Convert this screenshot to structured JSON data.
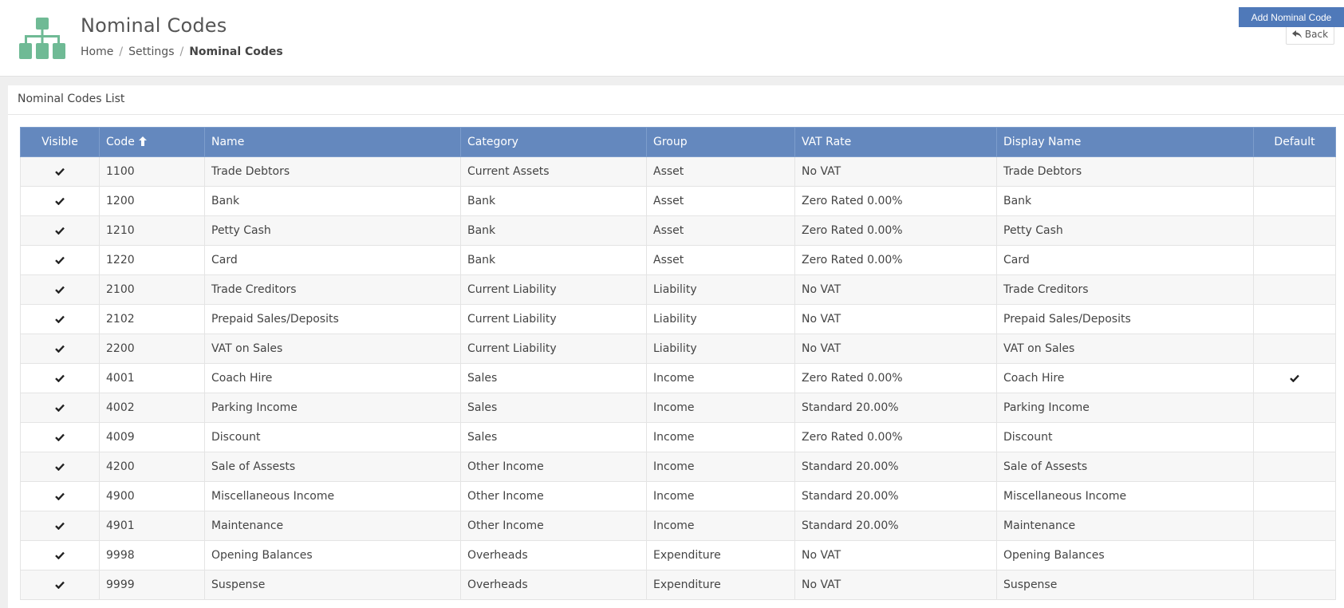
{
  "header": {
    "title": "Nominal Codes",
    "breadcrumb": [
      "Home",
      "Settings",
      "Nominal Codes"
    ],
    "back_label": "Back"
  },
  "colors": {
    "logo": "#6fba95",
    "table_header": "#6488be",
    "primary_button": "#4f79b9"
  },
  "panel": {
    "title": "Nominal Codes List",
    "add_button": "Add Nominal Code"
  },
  "table": {
    "columns": [
      "Visible",
      "Code",
      "Name",
      "Category",
      "Group",
      "VAT Rate",
      "Display Name",
      "Default"
    ],
    "sort": {
      "column": "Code",
      "direction": "ascending"
    },
    "rows": [
      {
        "visible": true,
        "code": "1100",
        "name": "Trade Debtors",
        "category": "Current Assets",
        "group": "Asset",
        "vat": "No VAT",
        "display": "Trade Debtors",
        "default": false
      },
      {
        "visible": true,
        "code": "1200",
        "name": "Bank",
        "category": "Bank",
        "group": "Asset",
        "vat": "Zero Rated 0.00%",
        "display": "Bank",
        "default": false
      },
      {
        "visible": true,
        "code": "1210",
        "name": "Petty Cash",
        "category": "Bank",
        "group": "Asset",
        "vat": "Zero Rated 0.00%",
        "display": "Petty Cash",
        "default": false
      },
      {
        "visible": true,
        "code": "1220",
        "name": "Card",
        "category": "Bank",
        "group": "Asset",
        "vat": "Zero Rated 0.00%",
        "display": "Card",
        "default": false
      },
      {
        "visible": true,
        "code": "2100",
        "name": "Trade Creditors",
        "category": "Current Liability",
        "group": "Liability",
        "vat": "No VAT",
        "display": "Trade Creditors",
        "default": false
      },
      {
        "visible": true,
        "code": "2102",
        "name": "Prepaid Sales/Deposits",
        "category": "Current Liability",
        "group": "Liability",
        "vat": "No VAT",
        "display": "Prepaid Sales/Deposits",
        "default": false
      },
      {
        "visible": true,
        "code": "2200",
        "name": "VAT on Sales",
        "category": "Current Liability",
        "group": "Liability",
        "vat": "No VAT",
        "display": "VAT on Sales",
        "default": false
      },
      {
        "visible": true,
        "code": "4001",
        "name": "Coach Hire",
        "category": "Sales",
        "group": "Income",
        "vat": "Zero Rated 0.00%",
        "display": "Coach Hire",
        "default": true
      },
      {
        "visible": true,
        "code": "4002",
        "name": "Parking Income",
        "category": "Sales",
        "group": "Income",
        "vat": "Standard 20.00%",
        "display": "Parking Income",
        "default": false
      },
      {
        "visible": true,
        "code": "4009",
        "name": "Discount",
        "category": "Sales",
        "group": "Income",
        "vat": "Zero Rated 0.00%",
        "display": "Discount",
        "default": false
      },
      {
        "visible": true,
        "code": "4200",
        "name": "Sale of Assests",
        "category": "Other Income",
        "group": "Income",
        "vat": "Standard 20.00%",
        "display": "Sale of Assests",
        "default": false
      },
      {
        "visible": true,
        "code": "4900",
        "name": "Miscellaneous Income",
        "category": "Other Income",
        "group": "Income",
        "vat": "Standard 20.00%",
        "display": "Miscellaneous Income",
        "default": false
      },
      {
        "visible": true,
        "code": "4901",
        "name": "Maintenance",
        "category": "Other Income",
        "group": "Income",
        "vat": "Standard 20.00%",
        "display": "Maintenance",
        "default": false
      },
      {
        "visible": true,
        "code": "9998",
        "name": "Opening Balances",
        "category": "Overheads",
        "group": "Expenditure",
        "vat": "No VAT",
        "display": "Opening Balances",
        "default": false
      },
      {
        "visible": true,
        "code": "9999",
        "name": "Suspense",
        "category": "Overheads",
        "group": "Expenditure",
        "vat": "No VAT",
        "display": "Suspense",
        "default": false
      }
    ]
  }
}
